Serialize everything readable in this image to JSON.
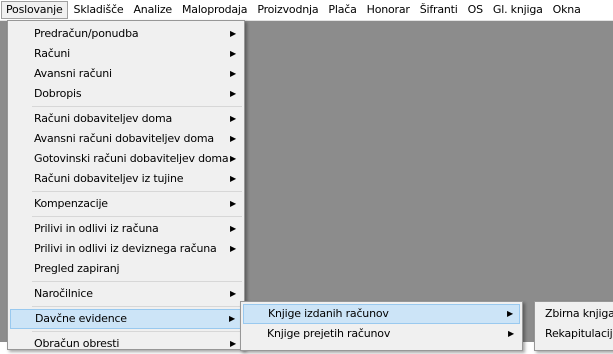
{
  "menubar": {
    "items": [
      {
        "label": "Poslovanje"
      },
      {
        "label": "Skladišče"
      },
      {
        "label": "Analize"
      },
      {
        "label": "Maloprodaja"
      },
      {
        "label": "Proizvodnja"
      },
      {
        "label": "Plača"
      },
      {
        "label": "Honorar"
      },
      {
        "label": "Šifranti"
      },
      {
        "label": "OS"
      },
      {
        "label": "Gl. knjiga"
      },
      {
        "label": "Okna"
      }
    ]
  },
  "poslovanje_menu": {
    "items": [
      {
        "label": "Predračun/ponudba"
      },
      {
        "label": "Računi"
      },
      {
        "label": "Avansni računi"
      },
      {
        "label": "Dobropis"
      },
      {
        "label": "Računi dobaviteljev doma"
      },
      {
        "label": "Avansni računi dobaviteljev doma"
      },
      {
        "label": "Gotovinski računi dobaviteljev doma"
      },
      {
        "label": "Računi dobaviteljev iz tujine"
      },
      {
        "label": "Kompenzacije"
      },
      {
        "label": "Prilivi in odlivi iz računa"
      },
      {
        "label": "Prilivi in odlivi iz deviznega računa"
      },
      {
        "label": "Pregled zapiranj"
      },
      {
        "label": "Naročilnice"
      },
      {
        "label": "Davčne evidence"
      },
      {
        "label": "Obračun obresti"
      }
    ]
  },
  "davcne_evidence_menu": {
    "items": [
      {
        "label": "Knjige izdanih računov"
      },
      {
        "label": "Knjige prejetih računov"
      }
    ]
  },
  "knjige_izdanih_menu": {
    "items": [
      {
        "label": "Zbirna knjiga"
      },
      {
        "label": "Rekapitulacija"
      }
    ]
  }
}
